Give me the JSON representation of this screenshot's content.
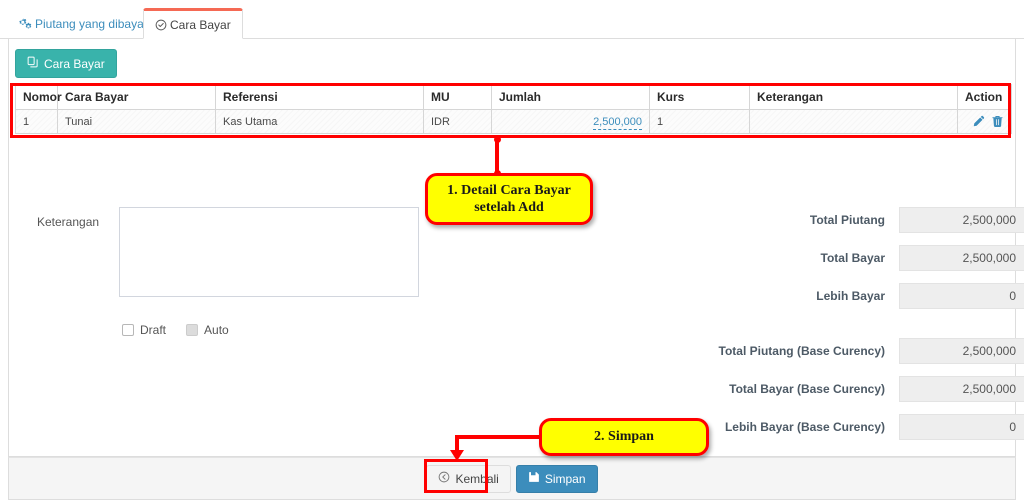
{
  "tabs": [
    {
      "label": "Piutang yang dibayar",
      "icon": "gears-icon",
      "active": false
    },
    {
      "label": "Cara Bayar",
      "icon": "check-circle-icon",
      "active": true
    }
  ],
  "toolbar": {
    "cara_bayar_label": "Cara Bayar",
    "cara_bayar_icon": "copy-icon"
  },
  "table": {
    "headers": [
      "Nomor",
      "Cara Bayar",
      "Referensi",
      "MU",
      "Jumlah",
      "Kurs",
      "Keterangan",
      "Action"
    ],
    "rows": [
      {
        "nomor": "1",
        "cara_bayar": "Tunai",
        "referensi": "Kas Utama",
        "mu": "IDR",
        "jumlah": "2,500,000",
        "kurs": "1",
        "keterangan": "",
        "actions": [
          "edit-icon",
          "delete-icon"
        ]
      }
    ]
  },
  "form": {
    "keterangan_label": "Keterangan",
    "keterangan_value": "",
    "keterangan_placeholder": "",
    "checkboxes": [
      {
        "label": "Draft",
        "checked": false,
        "disabled": false
      },
      {
        "label": "Auto",
        "checked": false,
        "disabled": true
      }
    ]
  },
  "totals": [
    {
      "label": "Total Piutang",
      "value": "2,500,000"
    },
    {
      "label": "Total Bayar",
      "value": "2,500,000"
    },
    {
      "label": "Lebih Bayar",
      "value": "0"
    },
    {
      "label": "Total Piutang (Base Curency)",
      "value": "2,500,000"
    },
    {
      "label": "Total Bayar (Base Curency)",
      "value": "2,500,000"
    },
    {
      "label": "Lebih Bayar (Base Curency)",
      "value": "0"
    }
  ],
  "footer": {
    "kembali_label": "Kembali",
    "kembali_icon": "back-circle-icon",
    "simpan_label": "Simpan",
    "simpan_icon": "save-icon"
  },
  "annotations": [
    {
      "id": 1,
      "text": "1. Detail Cara Bayar setelah Add"
    },
    {
      "id": 2,
      "text": "2. Simpan"
    }
  ],
  "colors": {
    "accent_teal": "#39b3ab",
    "accent_blue": "#3c8dbc",
    "annotation_red": "#ff0000",
    "annotation_yellow": "#ffff00",
    "tab_active_top": "#f56954"
  }
}
